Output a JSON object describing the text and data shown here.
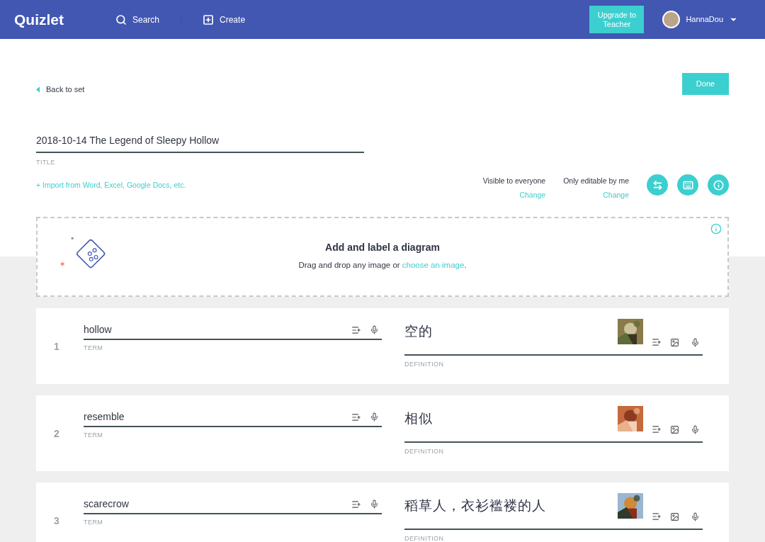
{
  "header": {
    "logo": "Quizlet",
    "nav": [
      {
        "kind": "search",
        "label": "Search"
      },
      {
        "kind": "create",
        "label": "Create"
      }
    ],
    "upgrade": "Upgrade to Teacher",
    "user": "HannaDou"
  },
  "back": "Back to set",
  "done": "Done",
  "title": {
    "value": "2018-10-14 The Legend of Sleepy Hollow",
    "label": "TITLE"
  },
  "import": "+ Import from Word, Excel, Google Docs, etc.",
  "permissions": [
    {
      "label": "Visible to everyone",
      "action": "Change"
    },
    {
      "label": "Only editable by me",
      "action": "Change"
    }
  ],
  "tools": [
    {
      "kind": "swap"
    },
    {
      "kind": "keyboard"
    },
    {
      "kind": "info"
    }
  ],
  "diagram": {
    "heading": "Add and label a diagram",
    "text": "Drag and drop any image or ",
    "link": "choose an image",
    "end": "."
  },
  "cards": [
    {
      "number": "1",
      "term": "hollow",
      "term_label": "TERM",
      "definition": "空的",
      "definition_label": "DEFINITION"
    },
    {
      "number": "2",
      "term": "resemble",
      "term_label": "TERM",
      "definition": "相似",
      "definition_label": "DEFINITION"
    },
    {
      "number": "3",
      "term": "scarecrow",
      "term_label": "TERM",
      "definition": "稻草人，衣衫褴褛的人",
      "definition_label": "DEFINITION"
    }
  ]
}
